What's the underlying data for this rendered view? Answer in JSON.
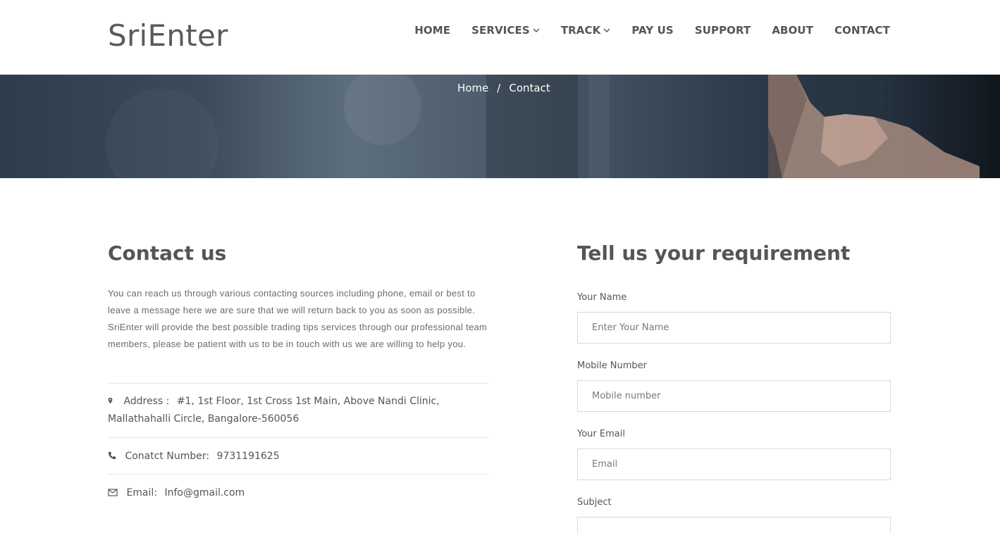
{
  "brand": {
    "logo": "SriEnter"
  },
  "nav": {
    "home": "HOME",
    "services": "SERVICES",
    "track": "TRACK",
    "payus": "PAY US",
    "support": "SUPPORT",
    "about": "ABOUT",
    "contact": "CONTACT"
  },
  "breadcrumb": {
    "home": "Home",
    "separator": "/",
    "current": "Contact"
  },
  "contact": {
    "title": "Contact us",
    "description": "You can reach us through various contacting sources including phone, email or best to leave a message here we are sure that we will return back to you as soon as possible. SriEnter will provide the best possible trading tips services through our professional team members, please be patient with us to be in touch with us we are willing to help you.",
    "address_label": "Address :",
    "address_value": "#1, 1st Floor, 1st Cross 1st Main, Above Nandi Clinic, Mallathahalli Circle, Bangalore-560056",
    "phone_label": "Conatct Number:",
    "phone_value": "9731191625",
    "email_label": "Email:",
    "email_value": "Info@gmail.com"
  },
  "form": {
    "title": "Tell us your requirement",
    "name_label": "Your Name",
    "name_placeholder": "Enter Your Name",
    "mobile_label": "Mobile Number",
    "mobile_placeholder": "Mobile number",
    "email_label": "Your Email",
    "email_placeholder": "Email",
    "subject_label": "Subject",
    "subject_placeholder": ""
  },
  "icons": {
    "chevron": "chevron-down-icon",
    "address": "map-marker-icon",
    "phone": "phone-icon",
    "email": "envelope-icon"
  }
}
